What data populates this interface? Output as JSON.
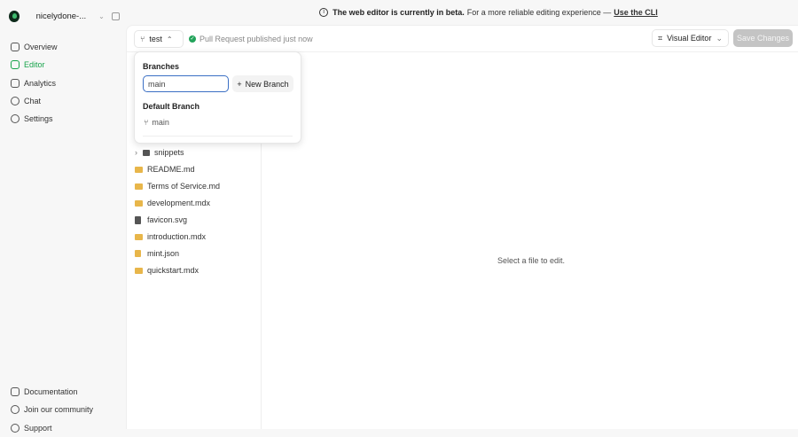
{
  "sidebar": {
    "project": "nicelydone-...",
    "items": [
      {
        "label": "Overview"
      },
      {
        "label": "Editor"
      },
      {
        "label": "Analytics"
      },
      {
        "label": "Chat"
      },
      {
        "label": "Settings"
      }
    ],
    "bottom": [
      {
        "label": "Documentation"
      },
      {
        "label": "Join our community"
      },
      {
        "label": "Support"
      }
    ]
  },
  "banner": {
    "bold": "The web editor is currently in beta.",
    "text": "For a more reliable editing experience —",
    "link": "Use the CLI"
  },
  "toolbar": {
    "branch": "test",
    "status": "Pull Request published just now",
    "mode": "Visual Editor",
    "save": "Save Changes"
  },
  "popup": {
    "title": "Branches",
    "input_value": "main",
    "new_branch": "New Branch",
    "default_title": "Default Branch",
    "default_branch": "main"
  },
  "files": [
    {
      "name": "snippets"
    },
    {
      "name": "README.md"
    },
    {
      "name": "Terms of Service.md"
    },
    {
      "name": "development.mdx"
    },
    {
      "name": "favicon.svg"
    },
    {
      "name": "introduction.mdx"
    },
    {
      "name": "mint.json"
    },
    {
      "name": "quickstart.mdx"
    }
  ],
  "empty_state": "Select a file to edit.",
  "colors": {
    "accent": "#16a34a",
    "input_focus": "#3b6fc4"
  }
}
